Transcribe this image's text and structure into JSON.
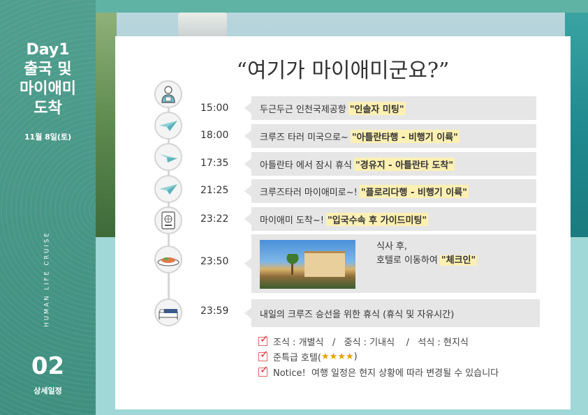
{
  "sidebar": {
    "day_lines": [
      "Day1",
      "출국 및",
      "마이애미",
      "도착"
    ],
    "date": "11월 8일(토)",
    "vertical_text": "HUMAN LIFE CRUISE",
    "section_number": "02",
    "section_label": "상세일정"
  },
  "title": "“여기가 마이애미군요?”",
  "timeline": [
    {
      "time": "15:00",
      "icon": "person-icon",
      "text": "두근두근 인천국제공항",
      "highlight": "\"인솔자 미팅\""
    },
    {
      "time": "18:00",
      "icon": "paper-plane-icon",
      "text": "크루즈 타러 미국으로~",
      "highlight": "\"아틀란타행 - 비행기 이륙\""
    },
    {
      "time": "17:35",
      "icon": "paper-plane-icon",
      "text": "아틀란타 에서 잠시 휴식 ",
      "highlight": "\"경유지 - 아틀란타 도착\""
    },
    {
      "time": "21:25",
      "icon": "paper-plane-icon",
      "text": "크루즈타러 마이애미로~!",
      "highlight": "\"플로리다행 - 비행기 이륙\""
    },
    {
      "time": "23:22",
      "icon": "passport-icon",
      "text": "마이애미 도착~!",
      "highlight": "\"입국수속 후 가이드미팅\""
    },
    {
      "time": "23:50",
      "icon": "meal-icon",
      "line1": "식사 후,",
      "text": "호텔로 이동하여",
      "highlight": "\"체크인\""
    },
    {
      "time": "23:59",
      "icon": "bed-icon",
      "text": "내일의 크루즈 승선을 위한 휴식 (휴식 및 자유시간)"
    }
  ],
  "notes": [
    {
      "text": "조식 : 개별식   /   중식 : 기내식    /   석식 : 현지식"
    },
    {
      "text": "준특급 호텔(",
      "stars": "★★★★",
      "suffix": ")"
    },
    {
      "text": "Notice!  여행 일정은 현지 상황에 따라 변경될 수 있습니다"
    }
  ]
}
